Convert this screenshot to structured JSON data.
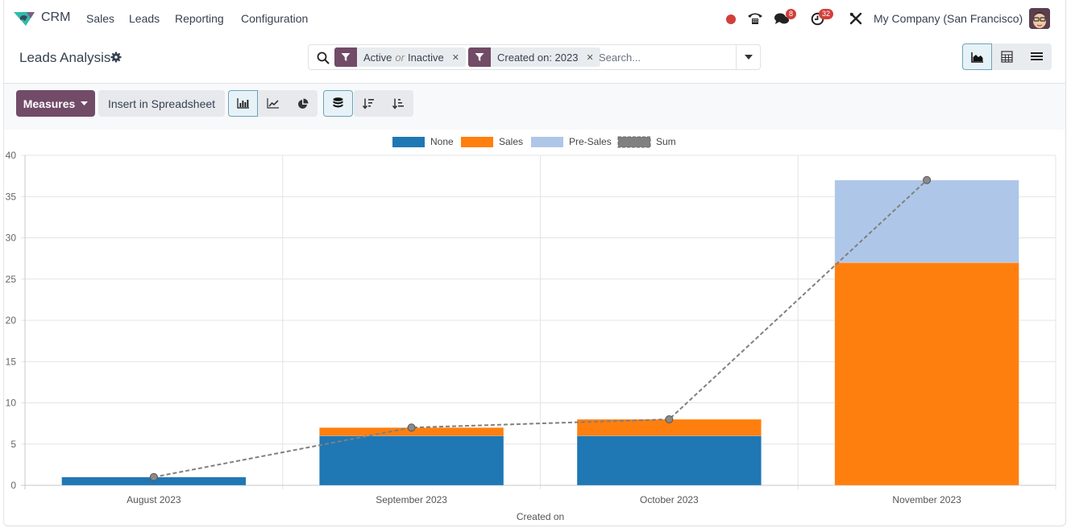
{
  "navbar": {
    "app_name": "CRM",
    "menu": [
      "Sales",
      "Leads",
      "Reporting",
      "Configuration"
    ],
    "messages_count": "8",
    "activities_count": "32",
    "company": "My Company (San Francisco)",
    "icons": [
      "status-dot-icon",
      "phone-icon",
      "chat-icon",
      "clock-icon",
      "tools-icon"
    ]
  },
  "control_panel": {
    "title": "Leads Analysis",
    "search": {
      "facets": [
        {
          "value_a": "Active",
          "sep": "or",
          "value_b": "Inactive"
        },
        {
          "value": "Created on: 2023"
        }
      ],
      "placeholder": "Search..."
    },
    "views": [
      "graph",
      "pivot",
      "list"
    ],
    "active_view": "graph"
  },
  "toolbar": {
    "measures_label": "Measures",
    "insert_label": "Insert in Spreadsheet",
    "chart_types": [
      "bar",
      "line",
      "pie"
    ],
    "active_chart_type": "bar",
    "stacked": true,
    "sort": [
      "descending",
      "ascending"
    ]
  },
  "colors": {
    "brand": "#714b67",
    "none": "#1f77b4",
    "sales": "#ff7f0e",
    "presales": "#aec7e8",
    "sum": "#808080"
  },
  "chart_data": {
    "type": "bar",
    "stacked": true,
    "categories": [
      "August 2023",
      "September 2023",
      "October 2023",
      "November 2023"
    ],
    "series": [
      {
        "name": "None",
        "values": [
          1,
          6,
          6,
          0
        ]
      },
      {
        "name": "Sales",
        "values": [
          0,
          1,
          2,
          27
        ]
      },
      {
        "name": "Pre-Sales",
        "values": [
          0,
          0,
          0,
          10
        ]
      }
    ],
    "line_series": {
      "name": "Sum",
      "values": [
        1,
        7,
        8,
        37
      ],
      "style": "dashed"
    },
    "xlabel": "Created on",
    "ylabel": "",
    "ylim": [
      0,
      40
    ],
    "yticks": [
      0,
      5,
      10,
      15,
      20,
      25,
      30,
      35,
      40
    ],
    "grid": true,
    "legend": "top-center"
  }
}
